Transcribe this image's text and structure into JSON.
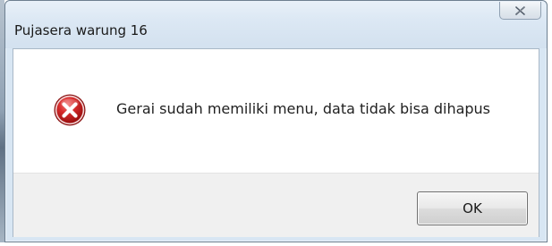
{
  "window": {
    "title": "Pujasera warung 16",
    "close_icon": "close-icon"
  },
  "dialog": {
    "icon": "error-icon",
    "message": "Gerai sudah memiliki menu, data tidak bisa dihapus",
    "ok_label": "OK"
  },
  "colors": {
    "titlebar": "#dce8f4",
    "error_red": "#d72b2b",
    "footer": "#f0f0f0"
  }
}
